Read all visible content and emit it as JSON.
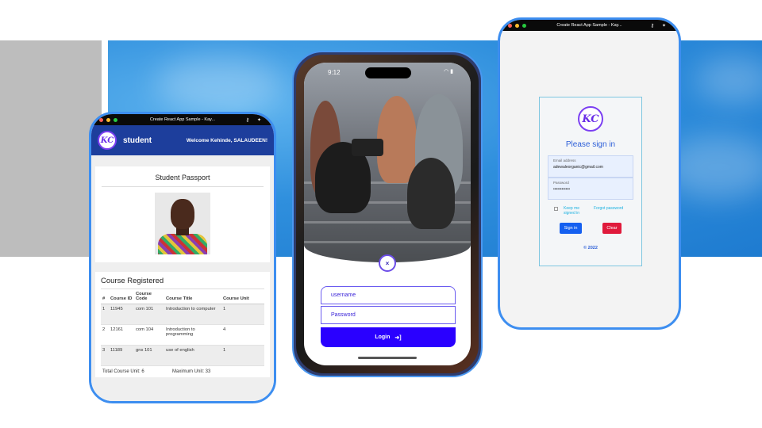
{
  "colors": {
    "accent_blue": "#3d8ef0",
    "header_navy": "#1d3e9c",
    "login_button": "#2a00ff",
    "signin_blue": "#1560f0",
    "clear_red": "#e01a3c"
  },
  "window": {
    "title": "Create React App Sample - Kay...",
    "key_icon": "key-icon",
    "puzzle_icon": "puzzle-icon"
  },
  "student_app": {
    "logo": "KC",
    "brand": "student",
    "welcome": "Welcome Kehinde, SALAUDEEN!",
    "passport_title": "Student Passport",
    "course_title": "Course Registered",
    "table_headers": [
      "#",
      "Course ID",
      "Course Code",
      "Course Title",
      "Course Unit"
    ],
    "rows": [
      [
        "1",
        "11945",
        "com 101",
        "Introduction to computer",
        "1"
      ],
      [
        "2",
        "12161",
        "com 104",
        "Introduction to programming",
        "4"
      ],
      [
        "3",
        "11189",
        "gns 101",
        "use of english",
        "1"
      ]
    ],
    "total_units": "Total Course Unit: 6",
    "max_units": "Maximum Unit: 33"
  },
  "mobile_login": {
    "time": "9:12",
    "close_label": "×",
    "username_placeholder": "username",
    "password_placeholder": "Password",
    "login_label": "Login",
    "login_icon": "➜]"
  },
  "signin": {
    "logo": "KC",
    "title": "Please sign in",
    "email_label": "Email address",
    "email_value": "adewaleorganic@gmail.com",
    "password_label": "Password",
    "password_value": "••••••••••••",
    "keep_signed": "Keep me signed in",
    "forgot": "Forgot password",
    "signin_button": "Sign in",
    "clear_button": "Clear",
    "copyright": "© 2022"
  }
}
